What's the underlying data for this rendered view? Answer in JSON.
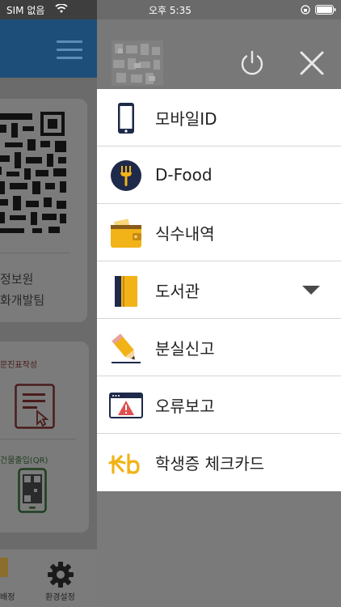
{
  "status_bar": {
    "carrier": "SIM 없음",
    "time": "오후 5:35"
  },
  "background_app": {
    "org_line1": "정보원",
    "org_line2": "화개발팀",
    "quick_label1": "문진표작성",
    "quick_label2": "건물출입(QR)",
    "tab1_label": "배정",
    "tab2_label": "환경설정"
  },
  "drawer": {
    "menu_items": [
      {
        "label": "모바일ID",
        "icon": "mobile-phone-icon"
      },
      {
        "label": "D-Food",
        "icon": "fork-icon"
      },
      {
        "label": "식수내역",
        "icon": "wallet-icon"
      },
      {
        "label": "도서관",
        "icon": "book-icon",
        "has_dropdown": true
      },
      {
        "label": "분실신고",
        "icon": "pencil-icon"
      },
      {
        "label": "오류보고",
        "icon": "warning-window-icon"
      },
      {
        "label": "학생증 체크카드",
        "icon": "kb-logo-icon"
      }
    ]
  },
  "colors": {
    "header_blue": "#1d4e79",
    "kb_yellow": "#f2b318",
    "navy": "#1f2a4a"
  }
}
